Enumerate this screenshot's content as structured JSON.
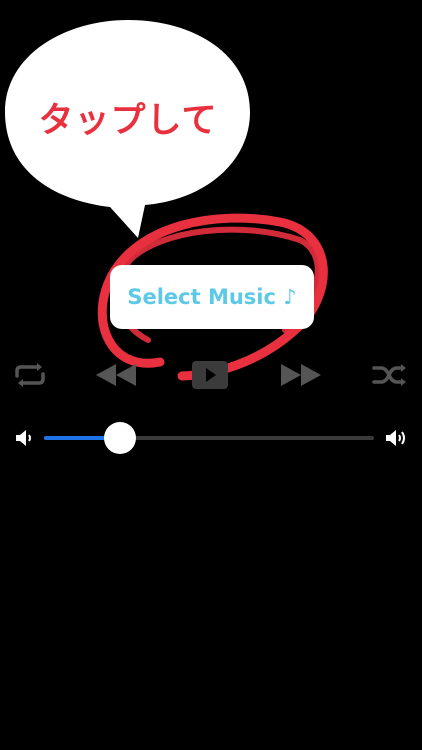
{
  "callout": {
    "text": "タップして"
  },
  "select_music_button": {
    "label": "Select Music ♪"
  },
  "controls": {
    "repeat_icon": "repeat-icon",
    "rewind_icon": "rewind-icon",
    "play_icon": "play-pause-icon",
    "forward_icon": "fast-forward-icon",
    "shuffle_icon": "shuffle-icon"
  },
  "volume": {
    "level": 0.23,
    "min_icon": "volume-low-icon",
    "max_icon": "volume-high-icon"
  },
  "colors": {
    "background": "#000000",
    "accent_red": "#e8303f",
    "button_text": "#5cc9e6",
    "slider_fill": "#1d74e8"
  }
}
